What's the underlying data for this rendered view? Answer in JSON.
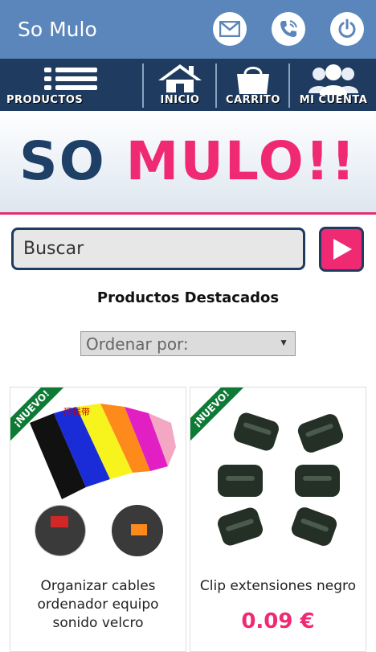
{
  "header": {
    "title": "So Mulo",
    "icons": [
      "mail-icon",
      "phone-icon",
      "power-icon"
    ]
  },
  "nav": {
    "items": [
      {
        "label": "PRODUCTOS",
        "icon": "list-icon"
      },
      {
        "label": "INICIO",
        "icon": "home-icon"
      },
      {
        "label": "CARRITO",
        "icon": "bag-icon"
      },
      {
        "label": "MI CUENTA",
        "icon": "users-icon"
      }
    ]
  },
  "banner": {
    "logo_so": "SO",
    "logo_mulo": "MULO",
    "logo_bang": "!!"
  },
  "search": {
    "placeholder": "Buscar"
  },
  "section": {
    "title": "Productos Destacados"
  },
  "sort": {
    "label": "Ordenar por:"
  },
  "products": [
    {
      "badge": "¡NUEVO!",
      "name": "Organizar cables ordenador equipo sonido velcro",
      "price": ""
    },
    {
      "badge": "¡NUEVO!",
      "name": "Clip extensiones negro",
      "price": "0.09 €"
    }
  ],
  "colors": {
    "top_bar": "#5b86bc",
    "nav_bar": "#1f3c60",
    "accent": "#ef2a73",
    "badge": "#0d7a35"
  }
}
